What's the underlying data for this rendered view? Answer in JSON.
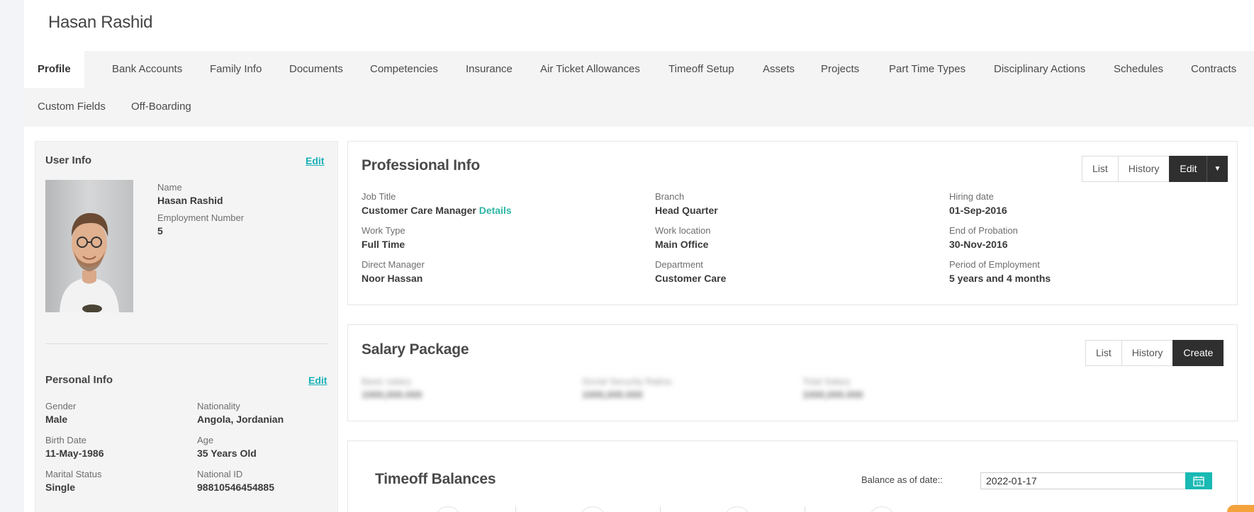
{
  "header": {
    "title": "Hasan Rashid"
  },
  "tabs": [
    {
      "label": "Profile",
      "active": true
    },
    {
      "label": "Bank Accounts"
    },
    {
      "label": "Family Info"
    },
    {
      "label": "Documents"
    },
    {
      "label": "Competencies"
    },
    {
      "label": "Insurance"
    },
    {
      "label": "Air Ticket Allowances"
    },
    {
      "label": "Timeoff Setup"
    },
    {
      "label": "Assets"
    },
    {
      "label": "Projects"
    },
    {
      "label": "Part Time Types"
    },
    {
      "label": "Disciplinary Actions"
    },
    {
      "label": "Schedules"
    },
    {
      "label": "Contracts"
    },
    {
      "label": "Custom Fields"
    },
    {
      "label": "Off-Boarding"
    }
  ],
  "user_info": {
    "title": "User Info",
    "edit_label": "Edit",
    "name_label": "Name",
    "name": "Hasan Rashid",
    "employment_number_label": "Employment Number",
    "employment_number": "5"
  },
  "personal_info": {
    "title": "Personal Info",
    "edit_label": "Edit",
    "gender_label": "Gender",
    "gender": "Male",
    "nationality_label": "Nationality",
    "nationality": "Angola, Jordanian",
    "birth_date_label": "Birth Date",
    "birth_date": "11-May-1986",
    "age_label": "Age",
    "age": "35 Years Old",
    "marital_status_label": "Marital Status",
    "marital_status": "Single",
    "national_id_label": "National ID",
    "national_id": "98810546454885"
  },
  "professional_info": {
    "title": "Professional Info",
    "buttons": {
      "list": "List",
      "history": "History",
      "edit": "Edit"
    },
    "job_title_label": "Job Title",
    "job_title": "Customer Care Manager",
    "details_link": "Details",
    "branch_label": "Branch",
    "branch": "Head Quarter",
    "hiring_date_label": "Hiring date",
    "hiring_date": "01-Sep-2016",
    "work_type_label": "Work Type",
    "work_type": "Full Time",
    "work_location_label": "Work location",
    "work_location": "Main Office",
    "end_probation_label": "End of Probation",
    "end_probation": "30-Nov-2016",
    "direct_manager_label": "Direct Manager",
    "direct_manager": "Noor Hassan",
    "department_label": "Department",
    "department": "Customer Care",
    "period_label": "Period of Employment",
    "period": "5 years and 4 months"
  },
  "salary_package": {
    "title": "Salary Package",
    "buttons": {
      "list": "List",
      "history": "History",
      "create": "Create"
    },
    "blurred": [
      {
        "label": "Basic salary",
        "value": "1000,000.000"
      },
      {
        "label": "Social Security Ratios",
        "value": "1000,000.000"
      },
      {
        "label": "Total Salary",
        "value": "1000,000.000"
      }
    ]
  },
  "timeoff_balances": {
    "title": "Timeoff Balances",
    "balance_label": "Balance as of date::",
    "balance_date": "2022-01-17"
  },
  "colors": {
    "accent": "#19b0b6",
    "dark_button": "#2f2f2f",
    "tab_bar": "#f4f4f4"
  }
}
